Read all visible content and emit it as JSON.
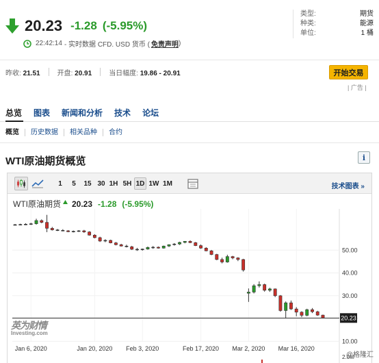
{
  "quote": {
    "price": "20.23",
    "change": "-1.28",
    "change_pct": "(-5.95%)",
    "time": "22:42:14",
    "meta": "- 实时数据 CFD. USD 货币 (",
    "disclaimer": "免责声明",
    "meta_end": ")"
  },
  "specs": [
    {
      "key": "类型:",
      "value": "期货"
    },
    {
      "key": "种类:",
      "value": "能源"
    },
    {
      "key": "单位:",
      "value": "1 桶"
    }
  ],
  "stats": {
    "prev_label": "昨收:",
    "prev_value": "21.51",
    "open_label": "开盘:",
    "open_value": "20.91",
    "range_label": "当日幅度:",
    "range_value": "19.86 - 20.91"
  },
  "trade_button": "开始交易",
  "ad_label": "| 广告 |",
  "tabs": [
    "总览",
    "图表",
    "新闻和分析",
    "技术",
    "论坛"
  ],
  "subtabs": [
    "概览",
    "历史数据",
    "相关品种",
    "合约"
  ],
  "section_title": "WTI原油期货概览",
  "info_icon": "i",
  "toolbar": {
    "periods": [
      "1",
      "5",
      "15",
      "30",
      "1H",
      "5H",
      "1D",
      "1W",
      "1M"
    ],
    "selected": "1D",
    "tech_chart": "技术图表 »"
  },
  "chart_data": {
    "type": "candlestick",
    "title": "WTI原油期货",
    "last_price": "20.23",
    "change": "-1.28",
    "change_pct": "(-5.95%)",
    "x_ticks": [
      "Jan 6, 2020",
      "Jan 20, 2020",
      "Feb 3, 2020",
      "Feb 17, 2020",
      "Mar 2, 2020",
      "Mar 16, 2020"
    ],
    "y_ticks": [
      "50.00",
      "40.00",
      "30.00",
      "20.00",
      "10.00"
    ],
    "y_min": 10,
    "y_max": 50,
    "ylim": [
      6.5,
      63
    ],
    "last_price_line": 20.23,
    "volume_label": "2.0M",
    "ohlc": [
      [
        61.2,
        61.5,
        60.9,
        61.2
      ],
      [
        61.2,
        61.6,
        61.0,
        61.3
      ],
      [
        61.3,
        61.8,
        61.0,
        61.4
      ],
      [
        61.4,
        62.0,
        61.1,
        61.6
      ],
      [
        61.6,
        63.8,
        61.2,
        63.0
      ],
      [
        63.0,
        63.5,
        61.8,
        62.2
      ],
      [
        62.2,
        65.5,
        57.9,
        59.6
      ],
      [
        59.6,
        60.2,
        58.6,
        58.9
      ],
      [
        58.9,
        59.3,
        58.4,
        58.7
      ],
      [
        58.7,
        59.2,
        58.3,
        58.5
      ],
      [
        58.5,
        58.8,
        57.9,
        58.1
      ],
      [
        58.1,
        58.6,
        57.8,
        58.3
      ],
      [
        58.3,
        58.8,
        58.0,
        58.5
      ],
      [
        58.5,
        58.9,
        57.6,
        58.0
      ],
      [
        58.0,
        58.3,
        56.4,
        56.6
      ],
      [
        56.6,
        57.0,
        55.2,
        55.5
      ],
      [
        55.5,
        55.9,
        53.6,
        54.0
      ],
      [
        54.0,
        54.8,
        53.5,
        54.3
      ],
      [
        54.3,
        54.6,
        53.0,
        53.2
      ],
      [
        53.2,
        53.6,
        52.1,
        52.4
      ],
      [
        52.4,
        52.8,
        51.6,
        51.8
      ],
      [
        51.8,
        52.4,
        51.2,
        51.5
      ],
      [
        51.5,
        51.9,
        50.1,
        50.4
      ],
      [
        50.4,
        51.0,
        49.7,
        50.2
      ],
      [
        50.2,
        50.7,
        49.8,
        50.5
      ],
      [
        50.5,
        51.6,
        50.2,
        51.2
      ],
      [
        51.2,
        51.8,
        50.6,
        51.3
      ],
      [
        51.3,
        51.6,
        50.7,
        50.9
      ],
      [
        50.9,
        52.0,
        50.7,
        51.8
      ],
      [
        51.8,
        52.6,
        51.4,
        52.4
      ],
      [
        52.4,
        53.1,
        52.0,
        52.7
      ],
      [
        52.7,
        53.7,
        52.3,
        53.4
      ],
      [
        53.4,
        54.0,
        53.0,
        53.9
      ],
      [
        53.9,
        54.3,
        53.1,
        53.3
      ],
      [
        53.3,
        53.6,
        51.8,
        52.0
      ],
      [
        52.0,
        52.5,
        50.6,
        50.9
      ],
      [
        50.9,
        51.3,
        49.5,
        49.7
      ],
      [
        49.7,
        50.1,
        47.8,
        48.1
      ],
      [
        48.1,
        48.4,
        45.6,
        45.9
      ],
      [
        45.9,
        46.7,
        44.2,
        44.8
      ],
      [
        44.8,
        48.0,
        44.5,
        47.2
      ],
      [
        47.2,
        47.5,
        46.0,
        46.6
      ],
      [
        46.6,
        46.9,
        45.2,
        45.9
      ],
      [
        45.9,
        46.2,
        40.6,
        41.3
      ],
      [
        31.1,
        33.2,
        27.3,
        31.6
      ],
      [
        31.6,
        35.1,
        31.0,
        34.4
      ],
      [
        34.4,
        36.3,
        33.6,
        34.9
      ],
      [
        34.9,
        35.3,
        31.8,
        32.4
      ],
      [
        32.4,
        33.5,
        31.7,
        33.0
      ],
      [
        33.0,
        33.2,
        29.4,
        30.0
      ],
      [
        30.0,
        30.3,
        23.0,
        23.5
      ],
      [
        23.5,
        27.5,
        20.1,
        26.9
      ],
      [
        26.9,
        27.9,
        23.8,
        24.2
      ],
      [
        24.2,
        25.0,
        21.0,
        22.8
      ],
      [
        22.8,
        23.2,
        20.6,
        21.4
      ],
      [
        21.4,
        24.3,
        21.0,
        23.9
      ],
      [
        23.9,
        24.6,
        22.4,
        23.0
      ],
      [
        23.0,
        23.4,
        21.2,
        21.5
      ],
      [
        21.5,
        21.7,
        20.1,
        20.3
      ]
    ]
  },
  "watermark": {
    "cn": "英为财情",
    "en": "Investing.com"
  },
  "credit": "@格隆汇"
}
